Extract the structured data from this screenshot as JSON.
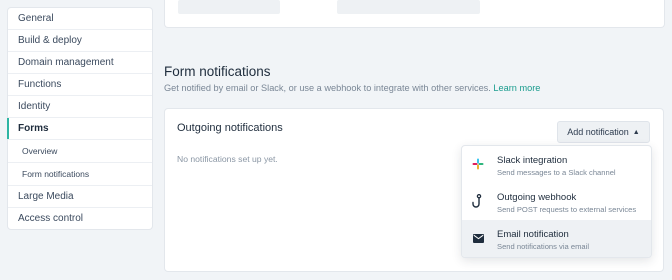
{
  "sidebar": {
    "items": [
      {
        "label": "General"
      },
      {
        "label": "Build & deploy"
      },
      {
        "label": "Domain management"
      },
      {
        "label": "Functions"
      },
      {
        "label": "Identity"
      },
      {
        "label": "Forms"
      },
      {
        "label": "Overview"
      },
      {
        "label": "Form notifications"
      },
      {
        "label": "Large Media"
      },
      {
        "label": "Access control"
      }
    ],
    "active": "Forms"
  },
  "section": {
    "title": "Form notifications",
    "description": "Get notified by email or Slack, or use a webhook to integrate with other services.",
    "learn_more": "Learn more"
  },
  "card": {
    "title": "Outgoing notifications",
    "empty_text": "No notifications set up yet.",
    "add_button": "Add notification"
  },
  "menu": {
    "items": [
      {
        "title": "Slack integration",
        "subtitle": "Send messages to a Slack channel",
        "icon": "slack-icon"
      },
      {
        "title": "Outgoing webhook",
        "subtitle": "Send POST requests to external services",
        "icon": "webhook-hook-icon"
      },
      {
        "title": "Email notification",
        "subtitle": "Send notifications via email",
        "icon": "envelope-icon"
      }
    ]
  },
  "colors": {
    "accent": "#2eb5a3",
    "link": "#1a9c8e",
    "background": "#f1f4f7"
  }
}
